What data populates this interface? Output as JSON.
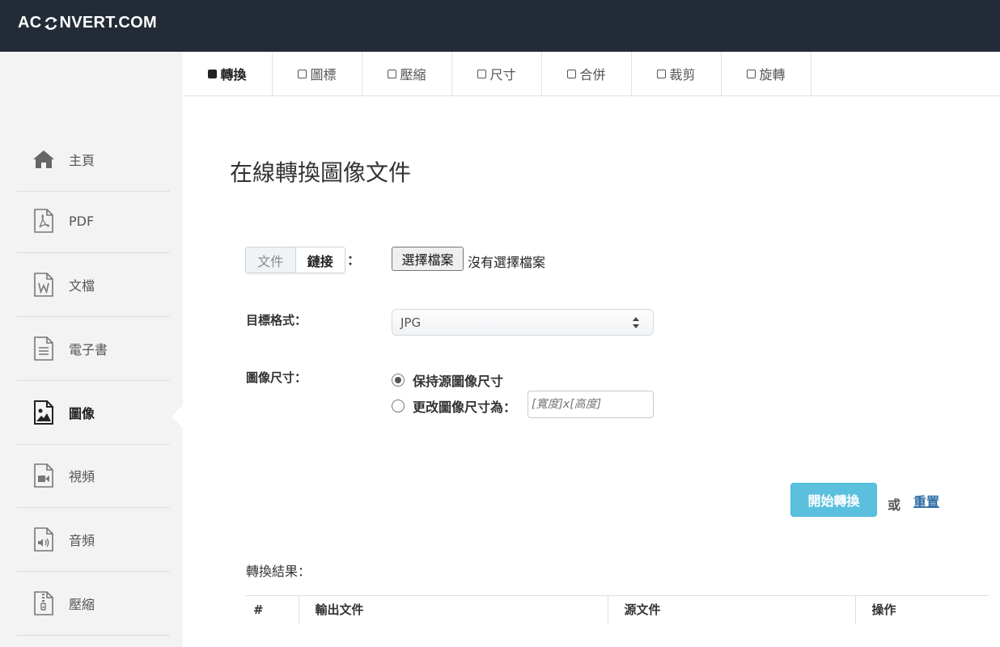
{
  "brand": {
    "logo_prefix": "AC",
    "logo_suffix": "NVERT.COM",
    "logo_icon": "refresh-arrows-icon"
  },
  "colors": {
    "topbar": "#222b36",
    "accent_button": "#5bc0de",
    "link": "#2e6da4"
  },
  "sidebar": {
    "items": [
      {
        "label": "主頁",
        "icon": "home-icon"
      },
      {
        "label": "PDF",
        "icon": "pdf-file-icon"
      },
      {
        "label": "文檔",
        "icon": "word-document-icon"
      },
      {
        "label": "電子書",
        "icon": "ebook-icon"
      },
      {
        "label": "圖像",
        "icon": "image-file-icon",
        "active": true
      },
      {
        "label": "視頻",
        "icon": "video-file-icon"
      },
      {
        "label": "音頻",
        "icon": "audio-file-icon"
      },
      {
        "label": "壓縮",
        "icon": "archive-file-icon"
      }
    ]
  },
  "tabs": [
    {
      "label": "轉換",
      "active": true
    },
    {
      "label": "圖標"
    },
    {
      "label": "壓縮"
    },
    {
      "label": "尺寸"
    },
    {
      "label": "合併"
    },
    {
      "label": "裁剪"
    },
    {
      "label": "旋轉"
    }
  ],
  "page": {
    "title": "在線轉換圖像文件"
  },
  "source": {
    "seg_file": "文件",
    "seg_link": "鏈接",
    "colon": "：",
    "choose_file": "選擇檔案",
    "no_file": "沒有選擇檔案"
  },
  "format": {
    "label": "目標格式：",
    "selected": "JPG"
  },
  "size": {
    "label": "圖像尺寸：",
    "keep_label": "保持源圖像尺寸",
    "change_label": "更改圖像尺寸為：",
    "placeholder": "[寬度]x[高度]"
  },
  "actions": {
    "convert": "開始轉換",
    "or": "或",
    "reset": "重置"
  },
  "results": {
    "label": "轉換結果：",
    "columns": [
      "#",
      "輸出文件",
      "源文件",
      "操作"
    ]
  }
}
